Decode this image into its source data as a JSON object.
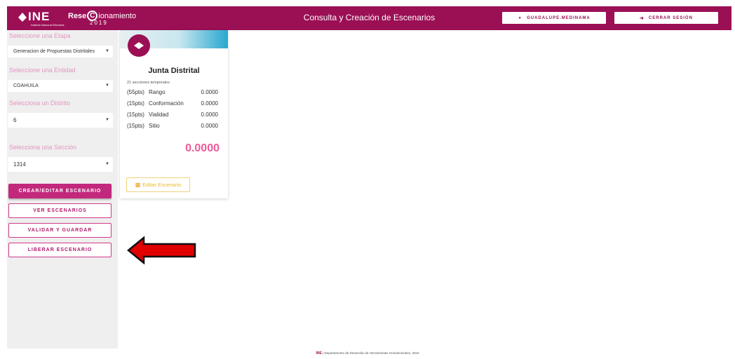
{
  "header": {
    "logo_text": "INE",
    "logo_sub": "Instituto Nacional Electoral",
    "brand_pre": "Rese",
    "brand_c": "C",
    "brand_post": "ionamiento",
    "brand_year": "2019",
    "title": "Consulta y Creación de Escenarios",
    "user_label": "GUADALUPE.MEDINAMA",
    "logout_label": "CERRAR SESIÓN"
  },
  "sidebar": {
    "etapa_label": "Seleccione una Etapa",
    "etapa_value": "Generacion de Propuestas Distritales",
    "entidad_label": "Seleccione una Entidad",
    "entidad_value": "COAHUILA",
    "distrito_label": "Selecciona un Distrito",
    "distrito_value": "6",
    "seccion_label": "Selecciona una Sección",
    "seccion_value": "1314",
    "buttons": {
      "crear": "CREAR/EDITAR ESCENARIO",
      "ver": "VER ESCENARIOS",
      "validar": "VALIDAR Y GUARDAR",
      "liberar": "LIBERAR ESCENARIO"
    }
  },
  "card": {
    "title": "Junta Distrital",
    "subtitle": "21 secciones temporales",
    "rows": [
      {
        "pts": "(55pts)",
        "name": "Rango",
        "value": "0.0000"
      },
      {
        "pts": "(15pts)",
        "name": "Conformación",
        "value": "0.0000"
      },
      {
        "pts": "(15pts)",
        "name": "Vialidad",
        "value": "0.0000"
      },
      {
        "pts": "(15pts)",
        "name": "Sitio",
        "value": "0.0000"
      }
    ],
    "total": "0.0000",
    "edit_label": "Editar Escenario"
  },
  "footer": {
    "logo": "INE",
    "text": "| Departamento de Desarrollo de Herramientas Geoelectorales, 2019"
  },
  "colors": {
    "brand": "#9b0f55",
    "accent_pink": "#c2287c",
    "total_pink": "#ee5a9b",
    "arrow_red": "#e00000"
  }
}
